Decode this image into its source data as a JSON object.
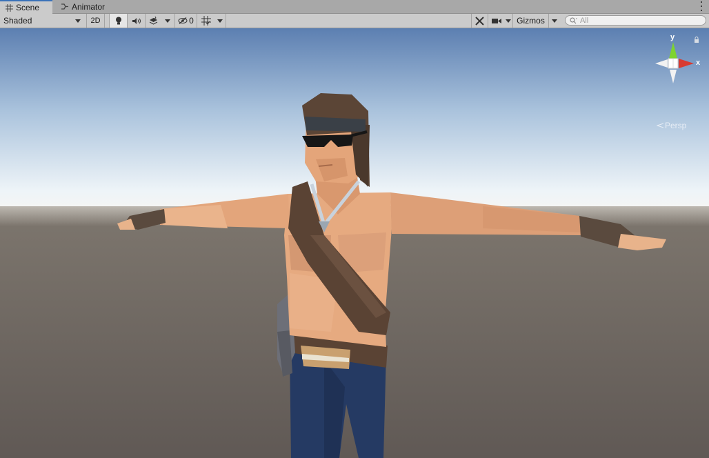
{
  "tabs": [
    {
      "label": "Scene",
      "icon": "grid-icon",
      "active": true
    },
    {
      "label": "Animator",
      "icon": "animator-icon",
      "active": false
    }
  ],
  "toolbar": {
    "draw_mode": "Shaded",
    "mode_2d": "2D",
    "hidden_count": "0",
    "gizmos_label": "Gizmos",
    "search_placeholder": "All"
  },
  "gizmo": {
    "y_label": "y",
    "x_label": "x",
    "projection": "Persp"
  },
  "colors": {
    "sky_top": "#5c7fb1",
    "sky_horizon": "#f4f8fb",
    "ground": "#66605a",
    "skin": "#e6aa80",
    "hair": "#5b4536",
    "pants": "#253a63",
    "strap": "#5a4334",
    "gizmo_y": "#7ed32f",
    "gizmo_x": "#d83a30"
  }
}
